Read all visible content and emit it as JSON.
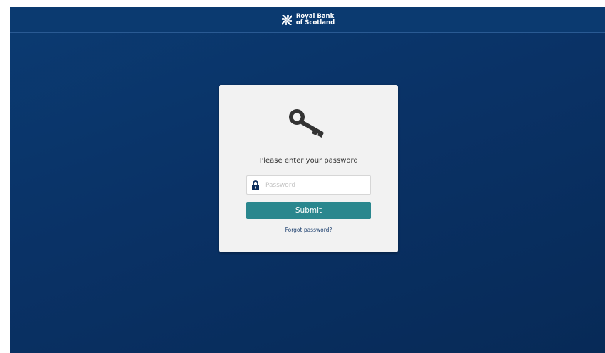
{
  "header": {
    "brand_name": "Royal Bank\nof Scotland",
    "logo_icon": "rbs-daisy-icon",
    "background_color": "#0b3a70"
  },
  "login": {
    "icon": "key-icon",
    "prompt": "Please enter your password",
    "password": {
      "icon": "lock-icon",
      "placeholder": "Password",
      "value": ""
    },
    "submit_label": "Submit",
    "forgot_label": "Forgot password?",
    "accent_color": "#2a878e",
    "card_color": "#f2f2f2"
  },
  "page": {
    "background_color": "#0a3266"
  }
}
